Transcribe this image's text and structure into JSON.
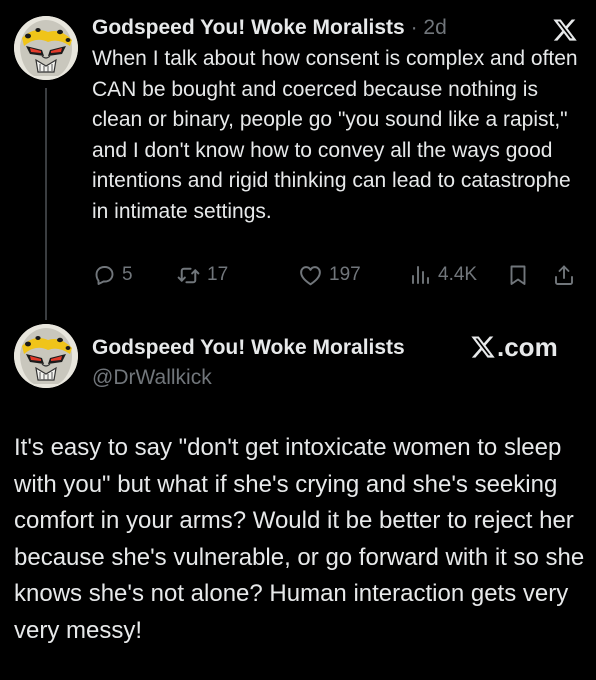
{
  "colors": {
    "background": "#000000",
    "text_primary": "#e7e9ea",
    "text_secondary": "#71767b",
    "thread_line": "#3a3d40"
  },
  "post": {
    "author_name": "Godspeed You! Woke Moralists",
    "separator": "·",
    "time": "2d",
    "body": "When I talk about how consent is complex and often CAN be bought and coerced because nothing is clean or binary, people go \"you sound like a rapist,\" and I don't know how to convey all the ways good intentions and rigid thinking can lead to catastrophe in intimate settings.",
    "metrics": {
      "replies": "5",
      "reposts": "17",
      "likes": "197",
      "views": "4.4K"
    },
    "icons": {
      "platform": "x-logo-icon",
      "reply": "reply-icon",
      "repost": "repost-icon",
      "like": "heart-icon",
      "views": "views-icon",
      "bookmark": "bookmark-icon",
      "share": "share-icon"
    }
  },
  "quoted_card": {
    "author_name": "Godspeed You! Woke Moralists",
    "handle": "@DrWallkick",
    "source": ".com",
    "body": "It's easy to say \"don't get intoxicate women to sleep with you\" but what if she's crying and she's seeking comfort in your arms? Would it be better to reject her because she's vulnerable, or go forward with it so she knows she's not alone? Human interaction gets very very messy!"
  }
}
